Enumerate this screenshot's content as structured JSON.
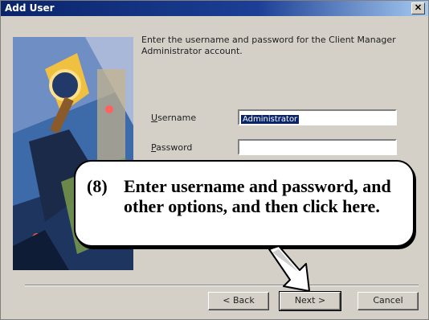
{
  "window": {
    "title": "Add User",
    "close_glyph": "✕"
  },
  "intro_text": "Enter the username and password for the Client Manager Administrator account.",
  "fields": {
    "username": {
      "label_accel": "U",
      "label_rest": "sername",
      "value": "Administrator"
    },
    "password": {
      "label_accel": "P",
      "label_rest": "assword",
      "value": ""
    }
  },
  "buttons": {
    "back": "< Back",
    "next": "Next >",
    "cancel": "Cancel"
  },
  "callout": {
    "number": "(8)",
    "text": "Enter username and password, and other options, and then click here."
  },
  "icons": {
    "wizard_art": "wizard-illustration",
    "arrow": "pointer-arrow-icon",
    "close": "close-icon"
  }
}
